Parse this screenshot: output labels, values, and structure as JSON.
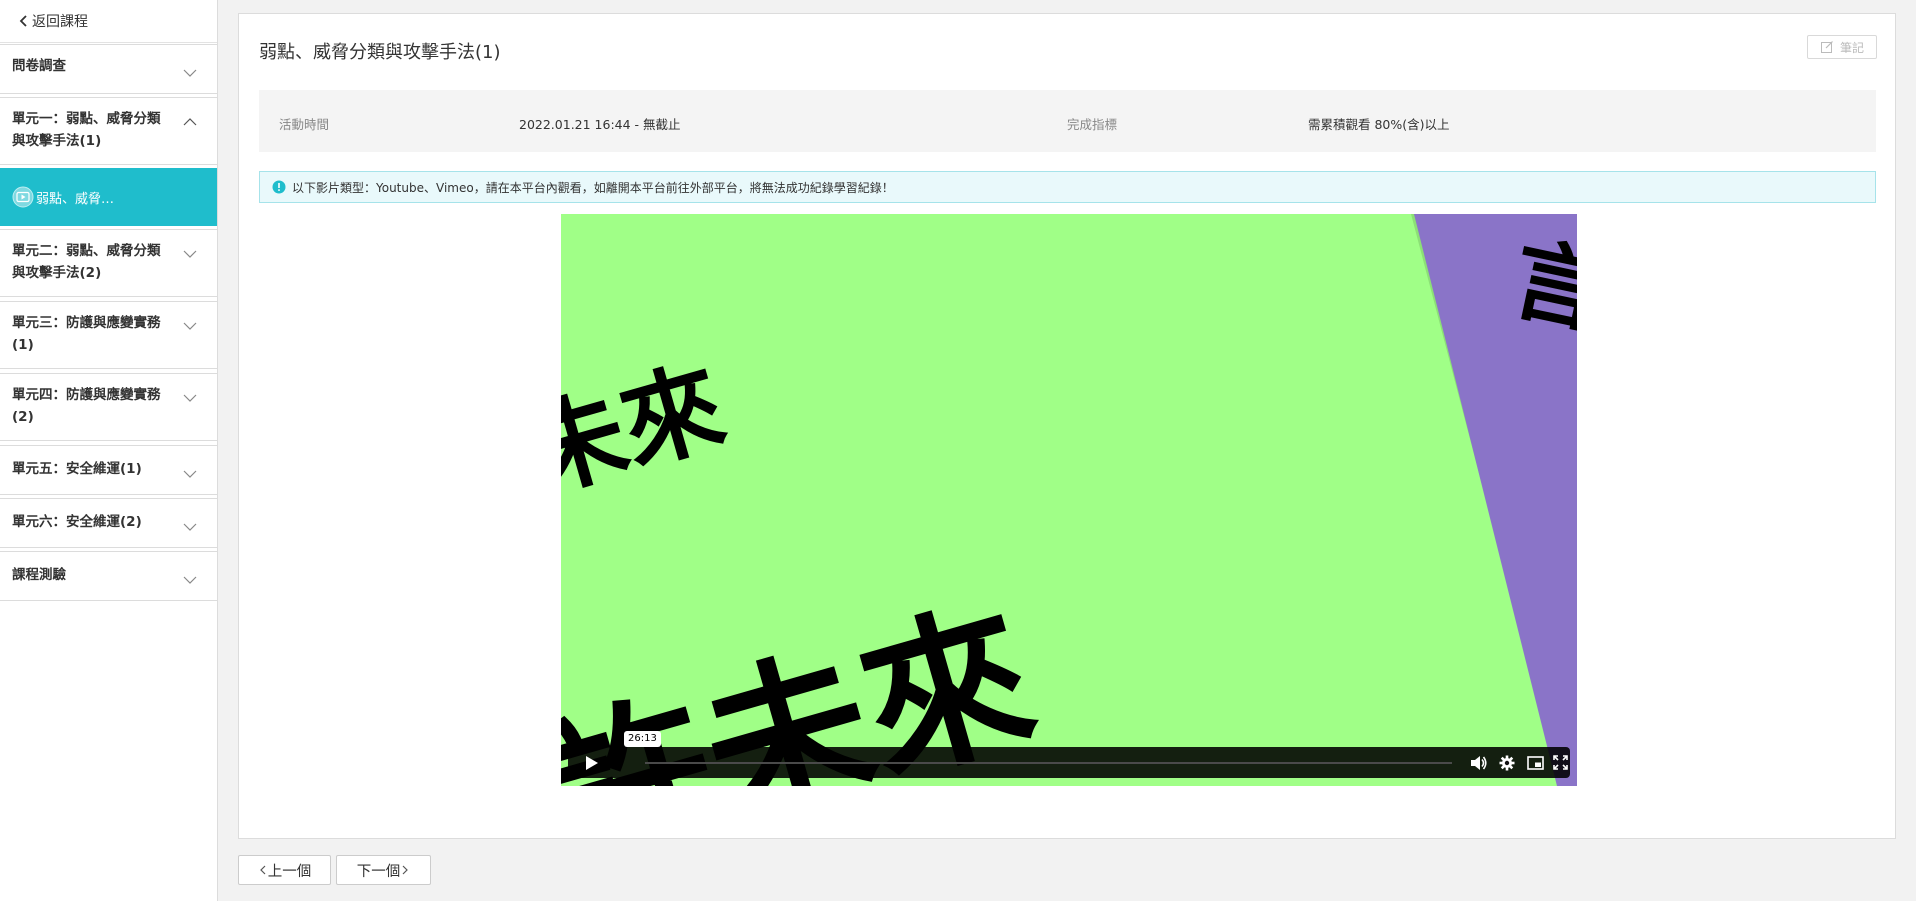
{
  "sidebar": {
    "back_label": "返回課程",
    "sections": [
      {
        "title": "問卷調查",
        "expanded": false
      },
      {
        "title": "單元一：弱點、威脅分類與攻擊手法(1)",
        "expanded": true
      },
      {
        "title": "單元二：弱點、威脅分類與攻擊手法(2)",
        "expanded": false
      },
      {
        "title": "單元三：防護與應變實務(1)",
        "expanded": false
      },
      {
        "title": "單元四：防護與應變實務(2)",
        "expanded": false
      },
      {
        "title": "單元五：安全維運(1)",
        "expanded": false
      },
      {
        "title": "單元六：安全維運(2)",
        "expanded": false
      },
      {
        "title": "課程測驗",
        "expanded": false
      }
    ],
    "active_item": {
      "label": "弱點、威脅…",
      "icon": "video-play-icon"
    }
  },
  "main": {
    "title": "弱點、威脅分類與攻擊手法(1)",
    "note_button": "筆記",
    "activity_time_label": "活動時間",
    "activity_time_value": "2022.01.21 16:44 - 無截止",
    "completion_label": "完成指標",
    "completion_value": "需累積觀看 80%(含)以上",
    "notice": "以下影片類型：Youtube、Vimeo，請在本平台內觀看，如離開本平台前往外部平台，將無法成功紀錄學習紀錄！"
  },
  "video": {
    "frame_text_large": "許未來",
    "frame_text_small": "未來",
    "duration_tooltip": "26:13",
    "progress": 0.0,
    "colors": {
      "background": "#a0ff87",
      "accent": "#8a74c8",
      "text": "#000000"
    }
  },
  "navigation": {
    "prev_label": "上一個",
    "next_label": "下一個"
  },
  "colors": {
    "accent": "#1fbdcc",
    "notice_bg": "#e9f9fb"
  }
}
